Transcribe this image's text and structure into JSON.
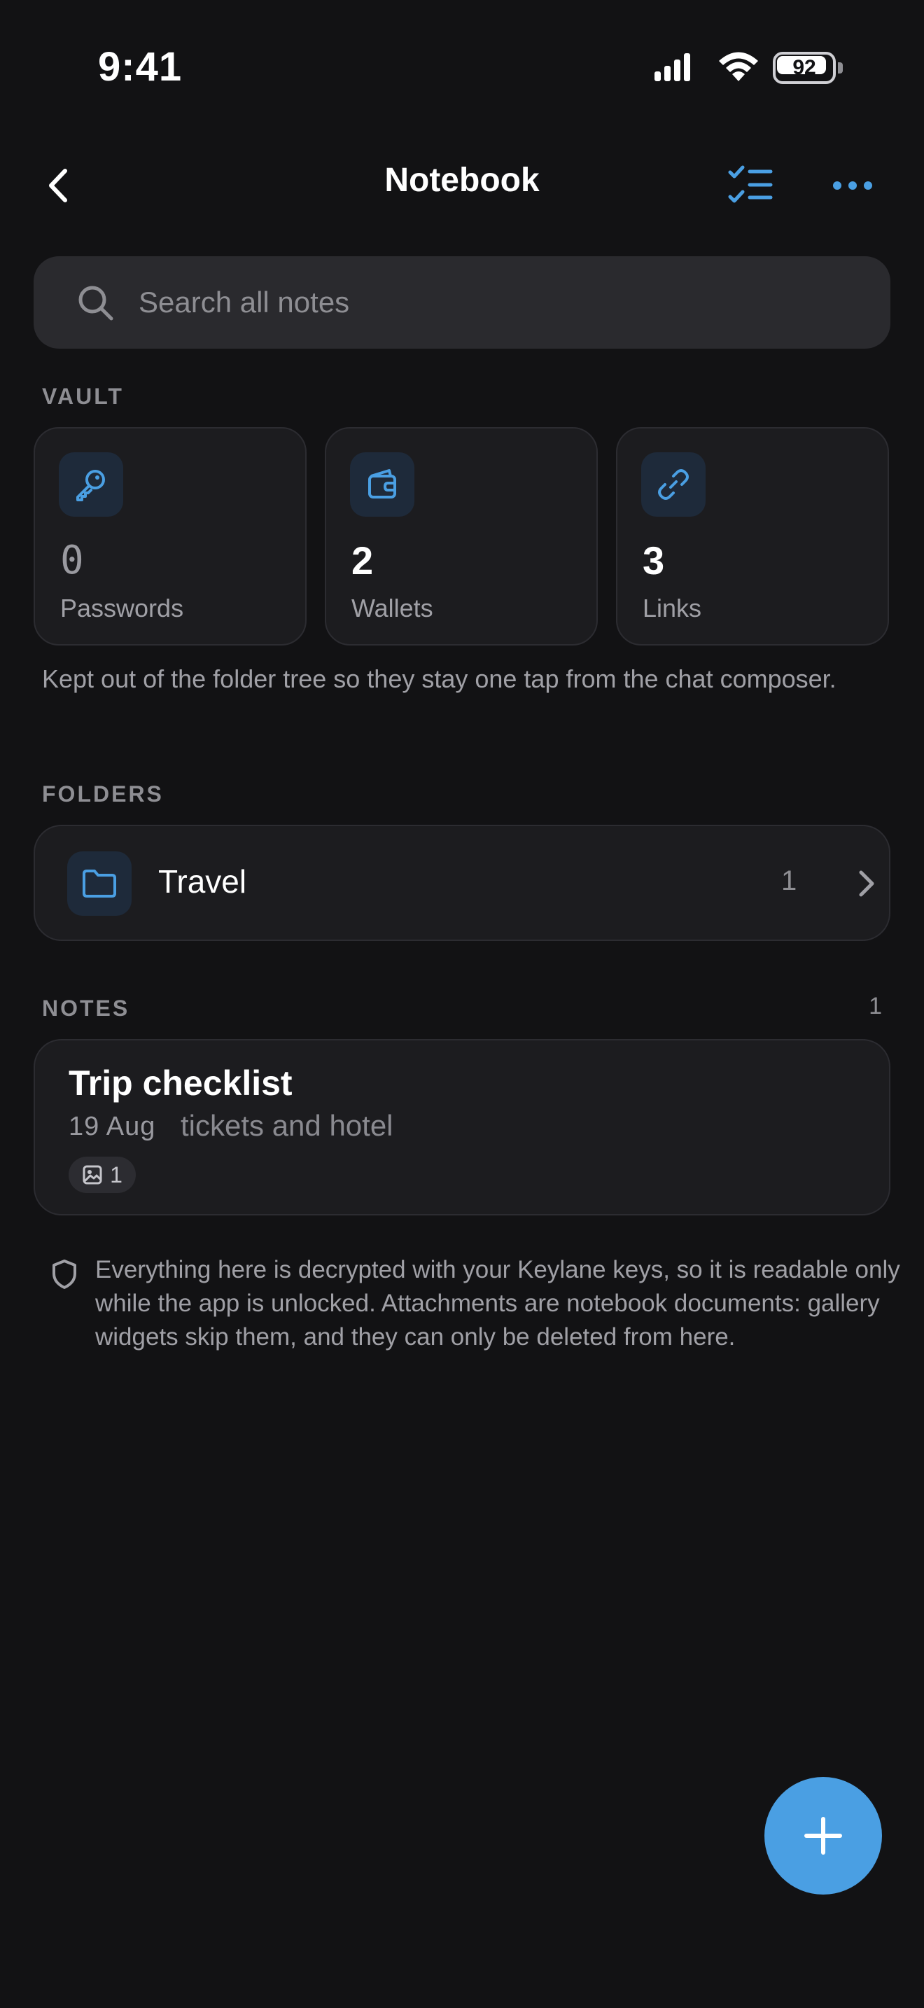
{
  "status_bar": {
    "time": "9:41",
    "battery_level": "92"
  },
  "nav": {
    "title": "Notebook"
  },
  "search": {
    "placeholder": "Search all notes"
  },
  "vault": {
    "section_label": "VAULT",
    "cards": [
      {
        "count": "0",
        "label": "Passwords",
        "icon": "key-icon"
      },
      {
        "count": "2",
        "label": "Wallets",
        "icon": "wallet-icon"
      },
      {
        "count": "3",
        "label": "Links",
        "icon": "link-icon"
      }
    ],
    "note": "Kept out of the folder tree so they stay one tap from the chat composer."
  },
  "folders": {
    "section_label": "FOLDERS",
    "items": [
      {
        "name": "Travel",
        "count": "1"
      }
    ]
  },
  "notes": {
    "section_label": "NOTES",
    "count": "1",
    "items": [
      {
        "title": "Trip checklist",
        "date": "19 Aug",
        "preview": "tickets and hotel",
        "attachments": "1"
      }
    ]
  },
  "footer": {
    "text": "Everything here is decrypted with your Keylane keys, so it is readable only while the app is unlocked. Attachments are notebook documents: gallery widgets skip them, and they can only be deleted from here."
  },
  "colors": {
    "background": "#121214",
    "card": "#1c1c1f",
    "accent": "#4a9fe3",
    "icon_tile": "#1e2a3a",
    "muted_text": "#8e8e93"
  }
}
